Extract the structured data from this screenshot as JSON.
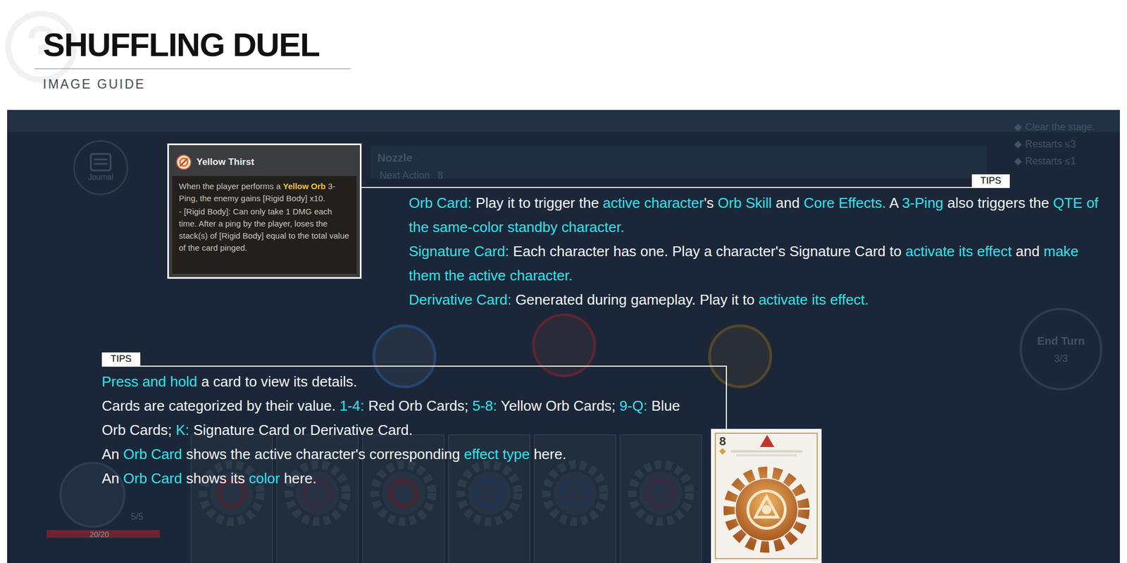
{
  "header": {
    "title": "SHUFFLING DUEL",
    "subtitle": "IMAGE GUIDE"
  },
  "tooltip": {
    "title": "Yellow Thirst",
    "body": [
      [
        {
          "text": "When the player performs a ",
          "highlight": false
        },
        {
          "text": "Yellow Orb",
          "highlight": true
        },
        {
          "text": " 3-Ping, the enemy gains [Rigid Body] x10.",
          "highlight": false
        }
      ],
      [
        {
          "text": "- [Rigid Body]: Can only take 1 DMG each time. After a ping by the player, loses the stack(s) of [Rigid Body] equal to the total value of the card pinged.",
          "highlight": false
        }
      ]
    ]
  },
  "tips_top": {
    "label": "TIPS",
    "paragraphs": [
      [
        {
          "text": "Orb Card:",
          "highlight": true
        },
        {
          "text": " Play it to trigger the ",
          "highlight": false
        },
        {
          "text": "active character",
          "highlight": true
        },
        {
          "text": "'s ",
          "highlight": false
        },
        {
          "text": "Orb Skill",
          "highlight": true
        },
        {
          "text": " and ",
          "highlight": false
        },
        {
          "text": "Core Effects.",
          "highlight": true
        },
        {
          "text": " A ",
          "highlight": false
        },
        {
          "text": "3-Ping",
          "highlight": true
        },
        {
          "text": " also triggers the ",
          "highlight": false
        },
        {
          "text": "QTE of the same-color standby character.",
          "highlight": true
        }
      ],
      [
        {
          "text": "Signature Card:",
          "highlight": true
        },
        {
          "text": " Each character has one. Play a character's Signature Card to ",
          "highlight": false
        },
        {
          "text": "activate its effect",
          "highlight": true
        },
        {
          "text": " and ",
          "highlight": false
        },
        {
          "text": "make them the active character.",
          "highlight": true
        }
      ],
      [
        {
          "text": "Derivative Card:",
          "highlight": true
        },
        {
          "text": " Generated during gameplay. Play it to ",
          "highlight": false
        },
        {
          "text": "activate its effect.",
          "highlight": true
        }
      ]
    ]
  },
  "tips_bottom": {
    "label": "TIPS",
    "paragraphs": [
      [
        {
          "text": "Press and hold",
          "highlight": true
        },
        {
          "text": " a card to view its details.",
          "highlight": false
        }
      ],
      [
        {
          "text": "Cards are categorized by their value. ",
          "highlight": false
        },
        {
          "text": "1-4:",
          "highlight": true
        },
        {
          "text": " Red Orb Cards; ",
          "highlight": false
        },
        {
          "text": "5-8:",
          "highlight": true
        },
        {
          "text": " Yellow Orb Cards; ",
          "highlight": false
        },
        {
          "text": "9-Q:",
          "highlight": true
        },
        {
          "text": " Blue Orb Cards; ",
          "highlight": false
        },
        {
          "text": "K:",
          "highlight": true
        },
        {
          "text": " Signature Card or Derivative Card.",
          "highlight": false
        }
      ],
      [
        {
          "text": "An ",
          "highlight": false
        },
        {
          "text": "Orb Card",
          "highlight": true
        },
        {
          "text": " shows the active character's corresponding ",
          "highlight": false
        },
        {
          "text": "effect type",
          "highlight": true
        },
        {
          "text": " here.",
          "highlight": false
        }
      ],
      [
        {
          "text": "An ",
          "highlight": false
        },
        {
          "text": "Orb Card",
          "highlight": true
        },
        {
          "text": " shows its ",
          "highlight": false
        },
        {
          "text": "color",
          "highlight": true
        },
        {
          "text": " here.",
          "highlight": false
        }
      ]
    ]
  },
  "example_card": {
    "value": "8"
  },
  "game_background": {
    "journal": "Journal",
    "enemy_name": "Nozzle",
    "next_action": "Next Action",
    "next_action_value": "8",
    "objectives": [
      "Clear the stage.",
      "Restarts ≤3",
      "Restarts ≤1"
    ],
    "end_turn": "End Turn",
    "turns": "3/3",
    "hp": "20/20",
    "hp_level": 1,
    "energy": "5/5"
  }
}
